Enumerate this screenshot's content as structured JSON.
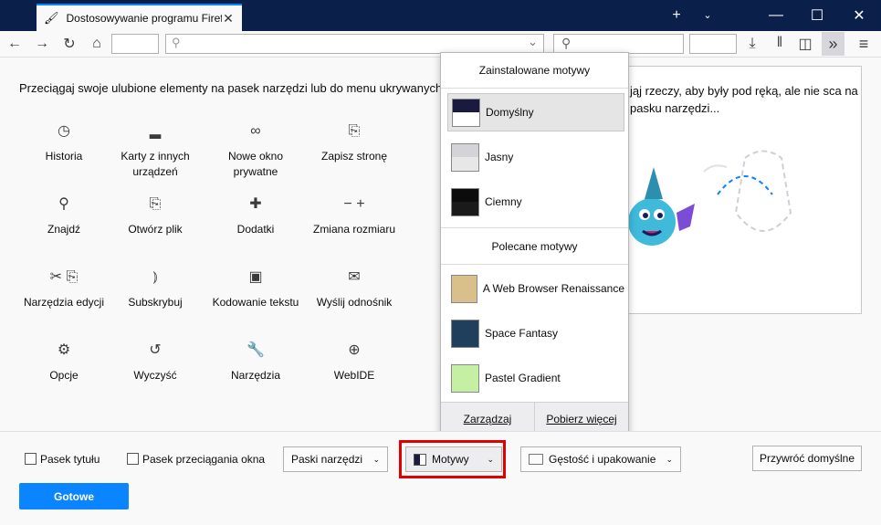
{
  "window": {
    "tab_title": "Dostosowywanie programu Firefox",
    "new_tab": "+",
    "minimize": "—",
    "maximize": "☐",
    "close": "✕"
  },
  "toolbar": {
    "back": "←",
    "forward": "→",
    "reload": "↻",
    "home": "⌂",
    "dropdown": "⌄",
    "download": "⤓",
    "library": "𝍪",
    "sidebar": "◫",
    "overflow": "»",
    "menu": "≡"
  },
  "instructions": "Przeciągaj swoje ulubione elementy na pasek narzędzi lub do menu ukrywanych",
  "palette": [
    {
      "icon": "◷",
      "label": "Historia"
    },
    {
      "icon": "▂",
      "label": "Karty z innych urządzeń"
    },
    {
      "icon": "∞",
      "label": "Nowe okno prywatne"
    },
    {
      "icon": "⎘",
      "label": "Zapisz stronę"
    },
    {
      "icon": "⚲",
      "label": "Znajdź"
    },
    {
      "icon": "⎘",
      "label": "Otwórz plik"
    },
    {
      "icon": "✚",
      "label": "Dodatki"
    },
    {
      "icon": "− +",
      "label": "Zmiana rozmiaru"
    },
    {
      "icon": "✂ ⎘",
      "label": "Narzędzia edycji"
    },
    {
      "icon": "⦆",
      "label": "Subskrybuj"
    },
    {
      "icon": "▣",
      "label": "Kodowanie tekstu"
    },
    {
      "icon": "✉",
      "label": "Wyślij odnośnik"
    },
    {
      "icon": "⚙",
      "label": "Opcje"
    },
    {
      "icon": "↺",
      "label": "Wyczyść"
    },
    {
      "icon": "🔧",
      "label": "Narzędzia"
    },
    {
      "icon": "⊕",
      "label": "WebIDE"
    }
  ],
  "overflow_panel": {
    "text": "jąj rzeczy, aby były pod ręką, ale nie sca na pasku narzędzi..."
  },
  "themes_popup": {
    "installed_header": "Zainstalowane motywy",
    "installed": [
      {
        "label": "Domyślny",
        "selected": true,
        "swatch": "#ffffff"
      },
      {
        "label": "Jasny",
        "selected": false,
        "swatch": "#e7e7e7"
      },
      {
        "label": "Ciemny",
        "selected": false,
        "swatch": "#1a1a1a"
      }
    ],
    "featured_header": "Polecane motywy",
    "featured": [
      {
        "label": "A Web Browser Renaissance",
        "swatch": "#d9c08a"
      },
      {
        "label": "Space Fantasy",
        "swatch": "#1f3f5c"
      },
      {
        "label": "Pastel Gradient",
        "swatch": "#c5f0a4"
      }
    ],
    "manage": "Zarządzaj",
    "get_more": "Pobierz więcej"
  },
  "footer": {
    "title_bar": "Pasek tytułu",
    "drag_space": "Pasek przeciągania okna",
    "toolbars": "Paski narzędzi",
    "themes": "Motywy",
    "density": "Gęstość i upakowanie",
    "restore": "Przywróć domyślne",
    "done": "Gotowe"
  },
  "colors": {
    "accent": "#0a84ff",
    "titlebar": "#0a1f4a",
    "highlight": "#e00000"
  }
}
